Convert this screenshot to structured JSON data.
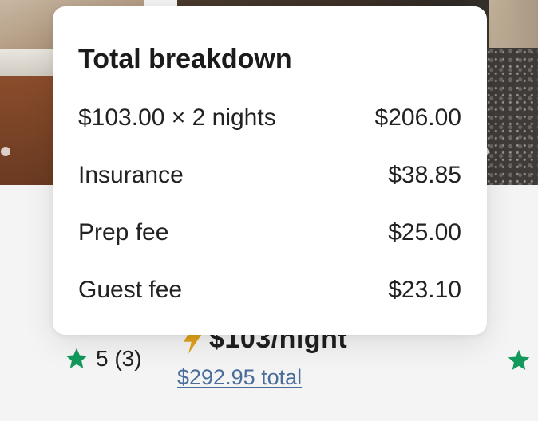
{
  "popover": {
    "title": "Total breakdown",
    "items": [
      {
        "label": "$103.00 × 2 nights",
        "amount": "$206.00"
      },
      {
        "label": "Insurance",
        "amount": "$38.85"
      },
      {
        "label": "Prep fee",
        "amount": "$25.00"
      },
      {
        "label": "Guest fee",
        "amount": "$23.10"
      }
    ]
  },
  "listing": {
    "rating": "5 (3)",
    "price": "$103/night",
    "total": "$292.95 total"
  },
  "colors": {
    "star": "#12995b",
    "bolt": "#e0a21a",
    "link": "#4a6d9a"
  }
}
